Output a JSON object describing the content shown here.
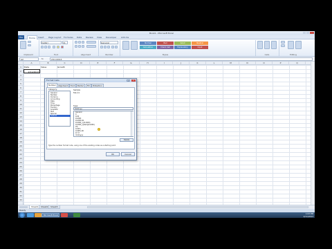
{
  "app": {
    "title": "Book1 - Microsoft Excel"
  },
  "ribbon_tabs": [
    "File",
    "Home",
    "Insert",
    "Page Layout",
    "Formulas",
    "Data",
    "Review",
    "View",
    "Developer",
    "Add-Ins"
  ],
  "ribbon": {
    "font_name": "Calibri",
    "font_size": "11",
    "number_format": "General",
    "groups": [
      "Clipboard",
      "Font",
      "Alignment",
      "Number",
      "Styles",
      "Cells",
      "Editing"
    ],
    "style_names": [
      "Normal",
      "Bad",
      "Good",
      "Neutral",
      "Calculation",
      "Check Cell",
      "Explanatory",
      "Input"
    ],
    "style_colors": [
      "#5b86c2",
      "#c0504d",
      "#9bbb59",
      "#f79646",
      "#4bacc6",
      "#8064a2",
      "#4f81bd",
      "#c0504d"
    ]
  },
  "formula_bar": {
    "name_box": "A2",
    "fx": "fx",
    "formula": "2/11/2013"
  },
  "columns": [
    "A",
    "B",
    "C",
    "D",
    "E",
    "F",
    "G",
    "H",
    "I",
    "J",
    "K",
    "L",
    "M",
    "N",
    "O",
    "P",
    "Q"
  ],
  "rows": [
    "1",
    "2",
    "3",
    "4",
    "5",
    "6",
    "7",
    "8",
    "9",
    "10",
    "11",
    "12",
    "13",
    "14",
    "15",
    "16",
    "17",
    "18",
    "19",
    "20",
    "21",
    "22",
    "23",
    "24",
    "25",
    "26",
    "27",
    "28",
    "29",
    "30",
    "31",
    "32",
    "33"
  ],
  "cells": {
    "A1": "Date",
    "B1": "Value",
    "C1": "Growth",
    "A2": "2/11/2013"
  },
  "sheet_tabs": [
    "Sheet1",
    "Sheet2",
    "Sheet3"
  ],
  "status": "Ready",
  "taskbar": {
    "task_label": "Microsoft Excel",
    "time": "1:03 PM",
    "date": "2/11/2013"
  },
  "dialog": {
    "title": "Format Cells",
    "help": "?",
    "close": "x",
    "tabs": [
      "Number",
      "Alignment",
      "Font",
      "Border",
      "Fill",
      "Protection"
    ],
    "category_label": "Category:",
    "categories": [
      "General",
      "Number",
      "Currency",
      "Accounting",
      "Date",
      "Time",
      "Percentage",
      "Fraction",
      "Scientific",
      "Text",
      "Special",
      "Custom"
    ],
    "selected_category": "Custom",
    "sample_label": "Sample",
    "sample_value": "Feb-11",
    "type_label": "Type:",
    "type_value": "mmm-yy",
    "types": [
      "General",
      "0",
      "0.00",
      "#,##0",
      "#,##0.00",
      "#,##0_);(#,##0)",
      "#,##0_);[Red](#,##0)",
      "0%",
      "0.00%",
      "0.00E+00",
      "# ?/?",
      "m/d/yyyy",
      "mmm-yy"
    ],
    "delete_label": "Delete",
    "description": "Type the number format code, using one of the existing codes as a starting point.",
    "ok_label": "OK",
    "cancel_label": "Cancel"
  }
}
